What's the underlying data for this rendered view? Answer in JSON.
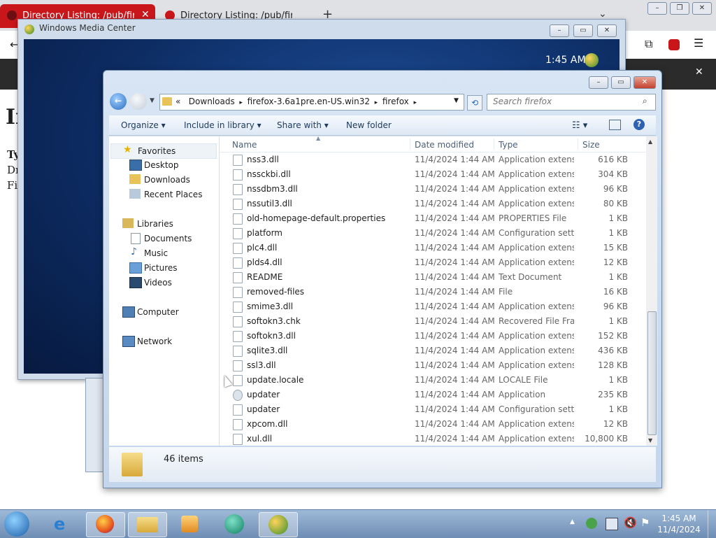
{
  "browser": {
    "tabs": [
      "Directory Listing: /pub/firefox/",
      "Directory Listing: /pub/firefox/"
    ],
    "new_tab": "+",
    "bg_heading": "In",
    "bg_lines": [
      "Ty",
      "Dr",
      "Fi"
    ]
  },
  "wmc": {
    "title": "Windows Media Center",
    "clock": "1:45 AM"
  },
  "explorer": {
    "breadcrumb": [
      "Downloads",
      "firefox-3.6a1pre.en-US.win32",
      "firefox"
    ],
    "search_placeholder": "Search firefox",
    "commands": {
      "organize": "Organize",
      "include": "Include in library",
      "share": "Share with",
      "new_folder": "New folder"
    },
    "nav": {
      "favorites": "Favorites",
      "desktop": "Desktop",
      "downloads": "Downloads",
      "recent": "Recent Places",
      "libraries": "Libraries",
      "documents": "Documents",
      "music": "Music",
      "pictures": "Pictures",
      "videos": "Videos",
      "computer": "Computer",
      "network": "Network"
    },
    "columns": {
      "name": "Name",
      "date": "Date modified",
      "type": "Type",
      "size": "Size"
    },
    "files": [
      {
        "name": "nss3.dll",
        "date": "11/4/2024 1:44 AM",
        "type": "Application extens...",
        "size": "616 KB"
      },
      {
        "name": "nssckbi.dll",
        "date": "11/4/2024 1:44 AM",
        "type": "Application extens...",
        "size": "304 KB"
      },
      {
        "name": "nssdbm3.dll",
        "date": "11/4/2024 1:44 AM",
        "type": "Application extens...",
        "size": "96 KB"
      },
      {
        "name": "nssutil3.dll",
        "date": "11/4/2024 1:44 AM",
        "type": "Application extens...",
        "size": "80 KB"
      },
      {
        "name": "old-homepage-default.properties",
        "date": "11/4/2024 1:44 AM",
        "type": "PROPERTIES File",
        "size": "1 KB"
      },
      {
        "name": "platform",
        "date": "11/4/2024 1:44 AM",
        "type": "Configuration sett...",
        "size": "1 KB"
      },
      {
        "name": "plc4.dll",
        "date": "11/4/2024 1:44 AM",
        "type": "Application extens...",
        "size": "15 KB"
      },
      {
        "name": "plds4.dll",
        "date": "11/4/2024 1:44 AM",
        "type": "Application extens...",
        "size": "12 KB"
      },
      {
        "name": "README",
        "date": "11/4/2024 1:44 AM",
        "type": "Text Document",
        "size": "1 KB"
      },
      {
        "name": "removed-files",
        "date": "11/4/2024 1:44 AM",
        "type": "File",
        "size": "16 KB"
      },
      {
        "name": "smime3.dll",
        "date": "11/4/2024 1:44 AM",
        "type": "Application extens...",
        "size": "96 KB"
      },
      {
        "name": "softokn3.chk",
        "date": "11/4/2024 1:44 AM",
        "type": "Recovered File Fra...",
        "size": "1 KB"
      },
      {
        "name": "softokn3.dll",
        "date": "11/4/2024 1:44 AM",
        "type": "Application extens...",
        "size": "152 KB"
      },
      {
        "name": "sqlite3.dll",
        "date": "11/4/2024 1:44 AM",
        "type": "Application extens...",
        "size": "436 KB"
      },
      {
        "name": "ssl3.dll",
        "date": "11/4/2024 1:44 AM",
        "type": "Application extens...",
        "size": "128 KB"
      },
      {
        "name": "update.locale",
        "date": "11/4/2024 1:44 AM",
        "type": "LOCALE File",
        "size": "1 KB"
      },
      {
        "name": "updater",
        "date": "11/4/2024 1:44 AM",
        "type": "Application",
        "size": "235 KB"
      },
      {
        "name": "updater",
        "date": "11/4/2024 1:44 AM",
        "type": "Configuration sett...",
        "size": "1 KB"
      },
      {
        "name": "xpcom.dll",
        "date": "11/4/2024 1:44 AM",
        "type": "Application extens...",
        "size": "12 KB"
      },
      {
        "name": "xul.dll",
        "date": "11/4/2024 1:44 AM",
        "type": "Application extens...",
        "size": "10,800 KB"
      }
    ],
    "status": "46 items"
  },
  "taskbar": {
    "time": "1:45 AM",
    "date": "11/4/2024"
  },
  "colors": {
    "wmc_bg": "#0d2c63",
    "taskbar": "#7f9cc2",
    "firefox_tab": "#c9161b"
  }
}
